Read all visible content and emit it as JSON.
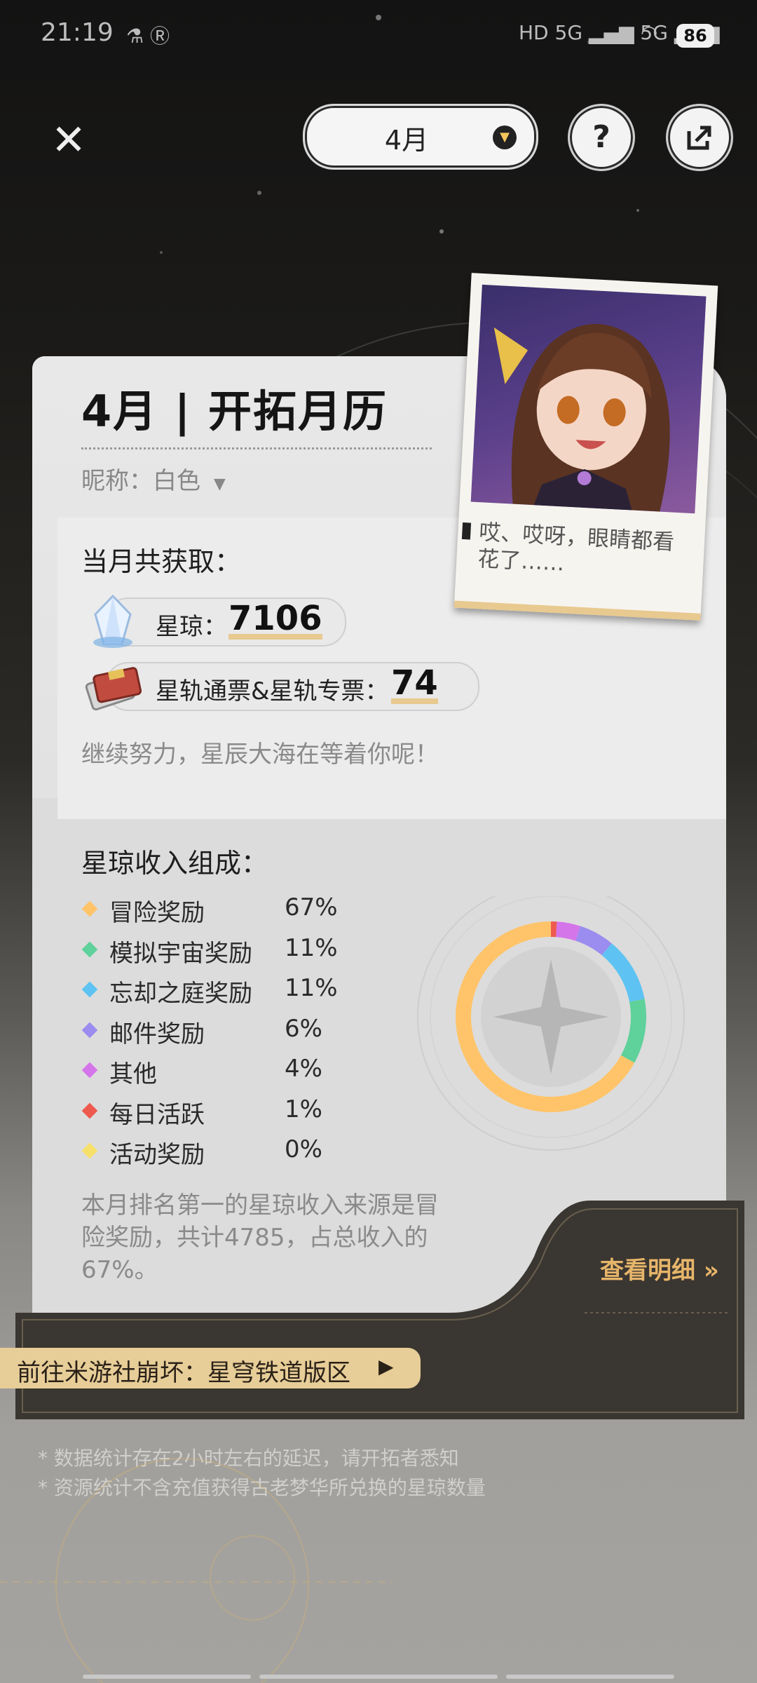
{
  "status_bar": {
    "time": "21:19",
    "battery": "86"
  },
  "header": {
    "month_selector": "4月",
    "help_label": "?"
  },
  "card": {
    "title": "4月 | 开拓月历",
    "nickname": "昵称：白色",
    "gain_title": "当月共获取：",
    "stellar_jade_label": "星琼：",
    "stellar_jade_value": "7106",
    "pass_label": "星轨通票&星轨专票：",
    "pass_value": "74",
    "encourage": "继续努力，星辰大海在等着你呢！",
    "photo_quote": "哎、哎呀，眼睛都看花了……",
    "composition_title": "星琼收入组成：",
    "composition": [
      {
        "name": "冒险奖励",
        "percent": "67%",
        "value": 67,
        "color": "#ffc46a"
      },
      {
        "name": "模拟宇宙奖励",
        "percent": "11%",
        "value": 11,
        "color": "#5fd19a"
      },
      {
        "name": "忘却之庭奖励",
        "percent": "11%",
        "value": 11,
        "color": "#5ec3f2"
      },
      {
        "name": "邮件奖励",
        "percent": "6%",
        "value": 6,
        "color": "#9b8cf0"
      },
      {
        "name": "其他",
        "percent": "4%",
        "value": 4,
        "color": "#d575ea"
      },
      {
        "name": "每日活跃",
        "percent": "1%",
        "value": 1,
        "color": "#ee5a4e"
      },
      {
        "name": "活动奖励",
        "percent": "0%",
        "value": 0,
        "color": "#f7e06a"
      }
    ],
    "summary": "本月排名第一的星琼收入来源是冒险奖励，共计4785，占总收入的67%。",
    "detail_link": "查看明细 »",
    "community_link": "前往米游社崩坏：星穹铁道版区"
  },
  "notes": [
    "* 数据统计存在2小时左右的延迟，请开拓者悉知",
    "* 资源统计不含充值获得古老梦华所兑换的星琼数量"
  ],
  "chart_data": {
    "type": "pie",
    "categories": [
      "冒险奖励",
      "模拟宇宙奖励",
      "忘却之庭奖励",
      "邮件奖励",
      "其他",
      "每日活跃",
      "活动奖励"
    ],
    "values": [
      67,
      11,
      11,
      6,
      4,
      1,
      0
    ],
    "colors": [
      "#ffc46a",
      "#5fd19a",
      "#5ec3f2",
      "#9b8cf0",
      "#d575ea",
      "#ee5a4e",
      "#f7e06a"
    ]
  }
}
